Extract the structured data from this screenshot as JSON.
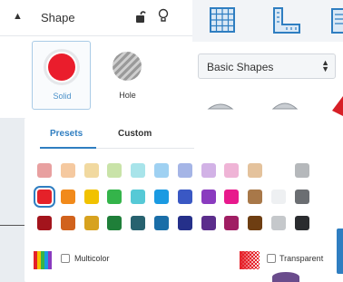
{
  "panel": {
    "title": "Shape",
    "solid_label": "Solid",
    "hole_label": "Hole",
    "solid_color": "#ea1d2c"
  },
  "shapes_library": {
    "selected": "Basic Shapes"
  },
  "picker": {
    "tabs": [
      "Presets",
      "Custom"
    ],
    "active_tab": "Presets",
    "selected_color": "#e52129",
    "rows": [
      [
        "#e8a0a0",
        "#f5c9a0",
        "#f1d9a0",
        "#c9e3a8",
        "#a8e4ea",
        "#9fd1f2",
        "#a5b5e6",
        "#d2b2e6",
        "#efb4d6",
        "#e4c29c",
        null,
        "#b5b8bb"
      ],
      [
        "#e52129",
        "#f18a1b",
        "#f1c200",
        "#34b44a",
        "#56c9d6",
        "#1a9ae2",
        "#3a58c4",
        "#8a3bbf",
        "#e8198c",
        "#a87849",
        "#eef0f2",
        "#6b6e72"
      ],
      [
        "#a3141c",
        "#d1621c",
        "#d7a21f",
        "#1f7f39",
        "#27626f",
        "#1a6ea8",
        "#25308a",
        "#5b2d8c",
        "#a01e63",
        "#6e3e12",
        "#c5c8cb",
        "#2a2c2f"
      ]
    ],
    "multicolor_label": "Multicolor",
    "transparent_label": "Transparent"
  },
  "icons": {
    "collapse": "caret-up-icon",
    "lock": "lock-icon",
    "light": "lightbulb-icon",
    "workplane": "workplane-icon",
    "ruler": "ruler-icon",
    "multicolor": "multicolor-icon",
    "transparent": "transparent-icon"
  },
  "colors": {
    "accent": "#2f7ec1",
    "icon_blue": "#2f7ec1"
  }
}
